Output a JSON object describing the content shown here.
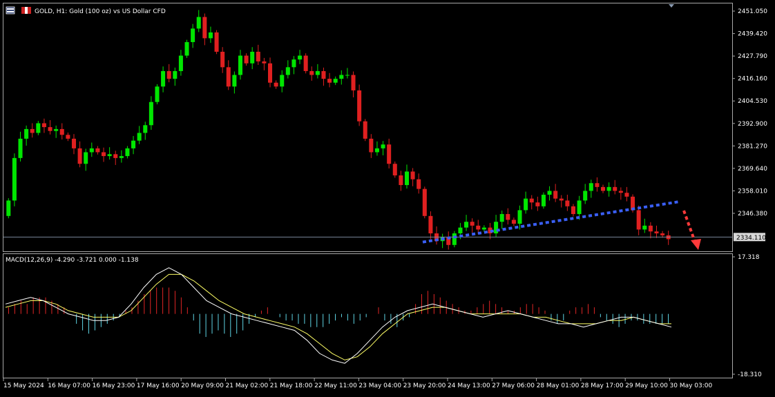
{
  "header": {
    "title": "GOLD, H1:  Gold (100 oz) vs US Dollar CFD",
    "icon1": "chart-window-icon",
    "icon2": "symbol-flag-icon"
  },
  "colors": {
    "background": "#000000",
    "frame": "#a9a9a9",
    "bull": "#00e600",
    "bear": "#e02020",
    "macd_pos": "#e02525",
    "macd_neg": "#5fd5e5",
    "macd_line": "#ffffff",
    "signal_line": "#ffff66",
    "trendline": "#3a5ff5",
    "projection": "#ff3a3a",
    "current_price_line": "#8a9ab0"
  },
  "chart_data": [
    {
      "type": "candlestick",
      "panel": "price",
      "symbol": "GOLD",
      "timeframe": "H1",
      "ylim": [
        2331.0,
        2452.5
      ],
      "y_ticks": [
        "2451.050",
        "2439.420",
        "2427.790",
        "2416.160",
        "2404.530",
        "2392.900",
        "2381.270",
        "2369.640",
        "2358.010",
        "2346.380"
      ],
      "current_price": "2334.110",
      "closes": [
        2353,
        2375,
        2385,
        2390,
        2388,
        2393,
        2391,
        2389,
        2390,
        2387,
        2385,
        2380,
        2372,
        2378,
        2380,
        2378,
        2376,
        2377,
        2375,
        2376,
        2380,
        2384,
        2388,
        2392,
        2404,
        2412,
        2420,
        2416,
        2420,
        2428,
        2435,
        2442,
        2448,
        2437,
        2440,
        2430,
        2422,
        2412,
        2418,
        2428,
        2424,
        2430,
        2425,
        2424,
        2414,
        2412,
        2418,
        2422,
        2426,
        2428,
        2420,
        2418,
        2420,
        2416,
        2414,
        2416,
        2418,
        2418,
        2410,
        2394,
        2385,
        2378,
        2380,
        2382,
        2372,
        2366,
        2361,
        2368,
        2364,
        2359,
        2345,
        2336,
        2332,
        2334,
        2330,
        2336,
        2339,
        2342,
        2340,
        2338,
        2339,
        2336,
        2342,
        2346,
        2343,
        2341,
        2348,
        2354,
        2352,
        2350,
        2356,
        2358,
        2354,
        2353,
        2350,
        2346,
        2353,
        2358,
        2362,
        2360,
        2358,
        2360,
        2358,
        2357,
        2355,
        2348,
        2338,
        2340,
        2337,
        2336,
        2335,
        2333
      ],
      "opens": [
        2345,
        2353,
        2375,
        2385,
        2390,
        2388,
        2393,
        2391,
        2389,
        2390,
        2387,
        2385,
        2380,
        2372,
        2378,
        2380,
        2378,
        2376,
        2377,
        2375,
        2376,
        2380,
        2384,
        2388,
        2392,
        2404,
        2412,
        2420,
        2416,
        2420,
        2428,
        2435,
        2442,
        2448,
        2437,
        2440,
        2430,
        2422,
        2412,
        2418,
        2428,
        2424,
        2430,
        2425,
        2424,
        2414,
        2412,
        2418,
        2422,
        2426,
        2428,
        2420,
        2418,
        2420,
        2416,
        2414,
        2416,
        2418,
        2418,
        2410,
        2394,
        2385,
        2378,
        2380,
        2382,
        2372,
        2366,
        2361,
        2368,
        2364,
        2359,
        2345,
        2336,
        2332,
        2334,
        2330,
        2336,
        2339,
        2342,
        2340,
        2338,
        2339,
        2336,
        2342,
        2346,
        2343,
        2341,
        2348,
        2354,
        2352,
        2350,
        2356,
        2358,
        2354,
        2353,
        2350,
        2346,
        2353,
        2358,
        2362,
        2360,
        2358,
        2360,
        2358,
        2357,
        2355,
        2348,
        2338,
        2340,
        2337,
        2336,
        2335
      ],
      "x_ticks": [
        "15 May 2024",
        "16 May 07:00",
        "16 May 23:00",
        "17 May 16:00",
        "20 May 09:00",
        "21 May 02:00",
        "21 May 18:00",
        "22 May 11:00",
        "23 May 04:00",
        "23 May 20:00",
        "24 May 13:00",
        "27 May 06:00",
        "28 May 01:00",
        "28 May 17:00",
        "29 May 10:00",
        "30 May 03:00"
      ],
      "annotations": [
        {
          "type": "trendline",
          "style": "dotted",
          "from": {
            "x": "23 May 20:00",
            "y": 2331.5
          },
          "to": {
            "x": "30 May 03:00",
            "y": 2352.5
          }
        },
        {
          "type": "arrow",
          "style": "dotted",
          "direction": "down"
        }
      ]
    },
    {
      "type": "indicator",
      "panel": "macd",
      "title": "MACD(12,26,9) -4.290 -3.721 0.000 -1.138",
      "ylim": [
        -18.31,
        17.318
      ],
      "y_ticks": [
        "17.318",
        "-18.310"
      ],
      "histogram": [
        2,
        3,
        4,
        3,
        5,
        5,
        5,
        4,
        3,
        2,
        0,
        -3,
        -5,
        -6,
        -5,
        -4,
        -3,
        -2,
        -1,
        1,
        2,
        4,
        6,
        7,
        8,
        8,
        8,
        7,
        5,
        2,
        -2,
        -6,
        -7,
        -6,
        -5,
        -6,
        -7,
        -6,
        -5,
        -3,
        -1,
        1,
        2,
        0,
        -1,
        -2,
        -2,
        -3,
        -3,
        -4,
        -4,
        -4,
        -3,
        -2,
        -1,
        -2,
        -3,
        -2,
        -1,
        0,
        2,
        -2,
        -3,
        -4,
        -2,
        -1,
        3,
        6,
        7,
        6,
        5,
        4,
        3,
        2,
        1,
        1,
        2,
        3,
        4,
        3,
        2,
        1,
        1,
        2,
        3,
        3,
        2,
        1,
        -2,
        -3,
        -2,
        1,
        2,
        2,
        3,
        2,
        -1,
        -2,
        -3,
        -4,
        -3,
        -2,
        -2,
        -3,
        -3,
        -3,
        -3,
        -3
      ],
      "macd_line": [
        3,
        4,
        5,
        4,
        2,
        0,
        -1,
        -2,
        -2,
        -1,
        3,
        8,
        12,
        14,
        12,
        8,
        4,
        2,
        0,
        -1,
        -2,
        -3,
        -4,
        -5,
        -8,
        -12,
        -14,
        -15,
        -12,
        -8,
        -4,
        -1,
        1,
        2,
        3,
        2,
        1,
        0,
        -1,
        0,
        1,
        0,
        -1,
        -2,
        -3,
        -3,
        -4,
        -3,
        -2,
        -1,
        -1,
        -2,
        -3,
        -4
      ],
      "signal_line": [
        2,
        3,
        4,
        4,
        3,
        1,
        0,
        -1,
        -1,
        -1,
        1,
        5,
        9,
        12,
        12,
        10,
        7,
        4,
        2,
        0,
        -1,
        -2,
        -3,
        -4,
        -6,
        -9,
        -12,
        -14,
        -13,
        -10,
        -6,
        -3,
        0,
        1,
        2,
        2,
        1,
        0,
        0,
        0,
        0,
        0,
        -1,
        -1,
        -2,
        -3,
        -3,
        -3,
        -2,
        -2,
        -1,
        -2,
        -3,
        -3
      ]
    }
  ]
}
